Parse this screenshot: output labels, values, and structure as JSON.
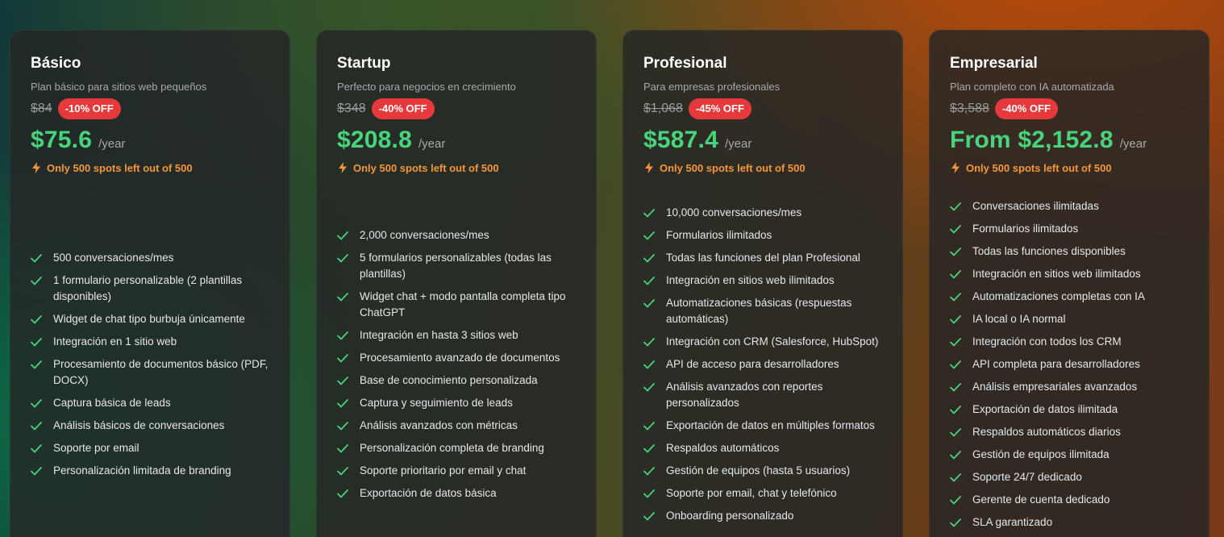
{
  "colors": {
    "accent_green": "#48d47d",
    "discount_red": "#e5393b",
    "spots_orange": "#f5963a"
  },
  "plans": [
    {
      "name": "Básico",
      "description": "Plan básico para sitios web pequeños",
      "old_price": "$84",
      "discount": "-10% OFF",
      "price": "$75.6",
      "period": "/year",
      "spots": "Only 500 spots left out of 500",
      "features": [
        "500 conversaciones/mes",
        "1 formulario personalizable (2 plantillas disponibles)",
        "Widget de chat tipo burbuja únicamente",
        "Integración en 1 sitio web",
        "Procesamiento de documentos básico (PDF, DOCX)",
        "Captura básica de leads",
        "Análisis básicos de conversaciones",
        "Soporte por email",
        "Personalización limitada de branding"
      ]
    },
    {
      "name": "Startup",
      "description": "Perfecto para negocios en crecimiento",
      "old_price": "$348",
      "discount": "-40% OFF",
      "price": "$208.8",
      "period": "/year",
      "spots": "Only 500 spots left out of 500",
      "features": [
        "2,000 conversaciones/mes",
        "5 formularios personalizables (todas las plantillas)",
        "Widget chat + modo pantalla completa tipo ChatGPT",
        "Integración en hasta 3 sitios web",
        "Procesamiento avanzado de documentos",
        "Base de conocimiento personalizada",
        "Captura y seguimiento de leads",
        "Análisis avanzados con métricas",
        "Personalización completa de branding",
        "Soporte prioritario por email y chat",
        "Exportación de datos básica"
      ]
    },
    {
      "name": "Profesional",
      "description": "Para empresas profesionales",
      "old_price": "$1,068",
      "discount": "-45% OFF",
      "price": "$587.4",
      "period": "/year",
      "spots": "Only 500 spots left out of 500",
      "features": [
        "10,000 conversaciones/mes",
        "Formularios ilimitados",
        "Todas las funciones del plan Profesional",
        "Integración en sitios web ilimitados",
        "Automatizaciones básicas (respuestas automáticas)",
        "Integración con CRM (Salesforce, HubSpot)",
        "API de acceso para desarrolladores",
        "Análisis avanzados con reportes personalizados",
        "Exportación de datos en múltiples formatos",
        "Respaldos automáticos",
        "Gestión de equipos (hasta 5 usuarios)",
        "Soporte por email, chat y telefónico",
        "Onboarding personalizado"
      ]
    },
    {
      "name": "Empresarial",
      "description": "Plan completo con IA automatizada",
      "old_price": "$3,588",
      "discount": "-40% OFF",
      "price": "From $2,152.8",
      "period": "/year",
      "spots": "Only 500 spots left out of 500",
      "features": [
        "Conversaciones ilimitadas",
        "Formularios ilimitados",
        "Todas las funciones disponibles",
        "Integración en sitios web ilimitados",
        "Automatizaciones completas con IA",
        "IA local o IA normal",
        "Integración con todos los CRM",
        "API completa para desarrolladores",
        "Análisis empresariales avanzados",
        "Exportación de datos ilimitada",
        "Respaldos automáticos diarios",
        "Gestión de equipos ilimitada",
        "Soporte 24/7 dedicado",
        "Gerente de cuenta dedicado",
        "SLA garantizado"
      ]
    }
  ]
}
